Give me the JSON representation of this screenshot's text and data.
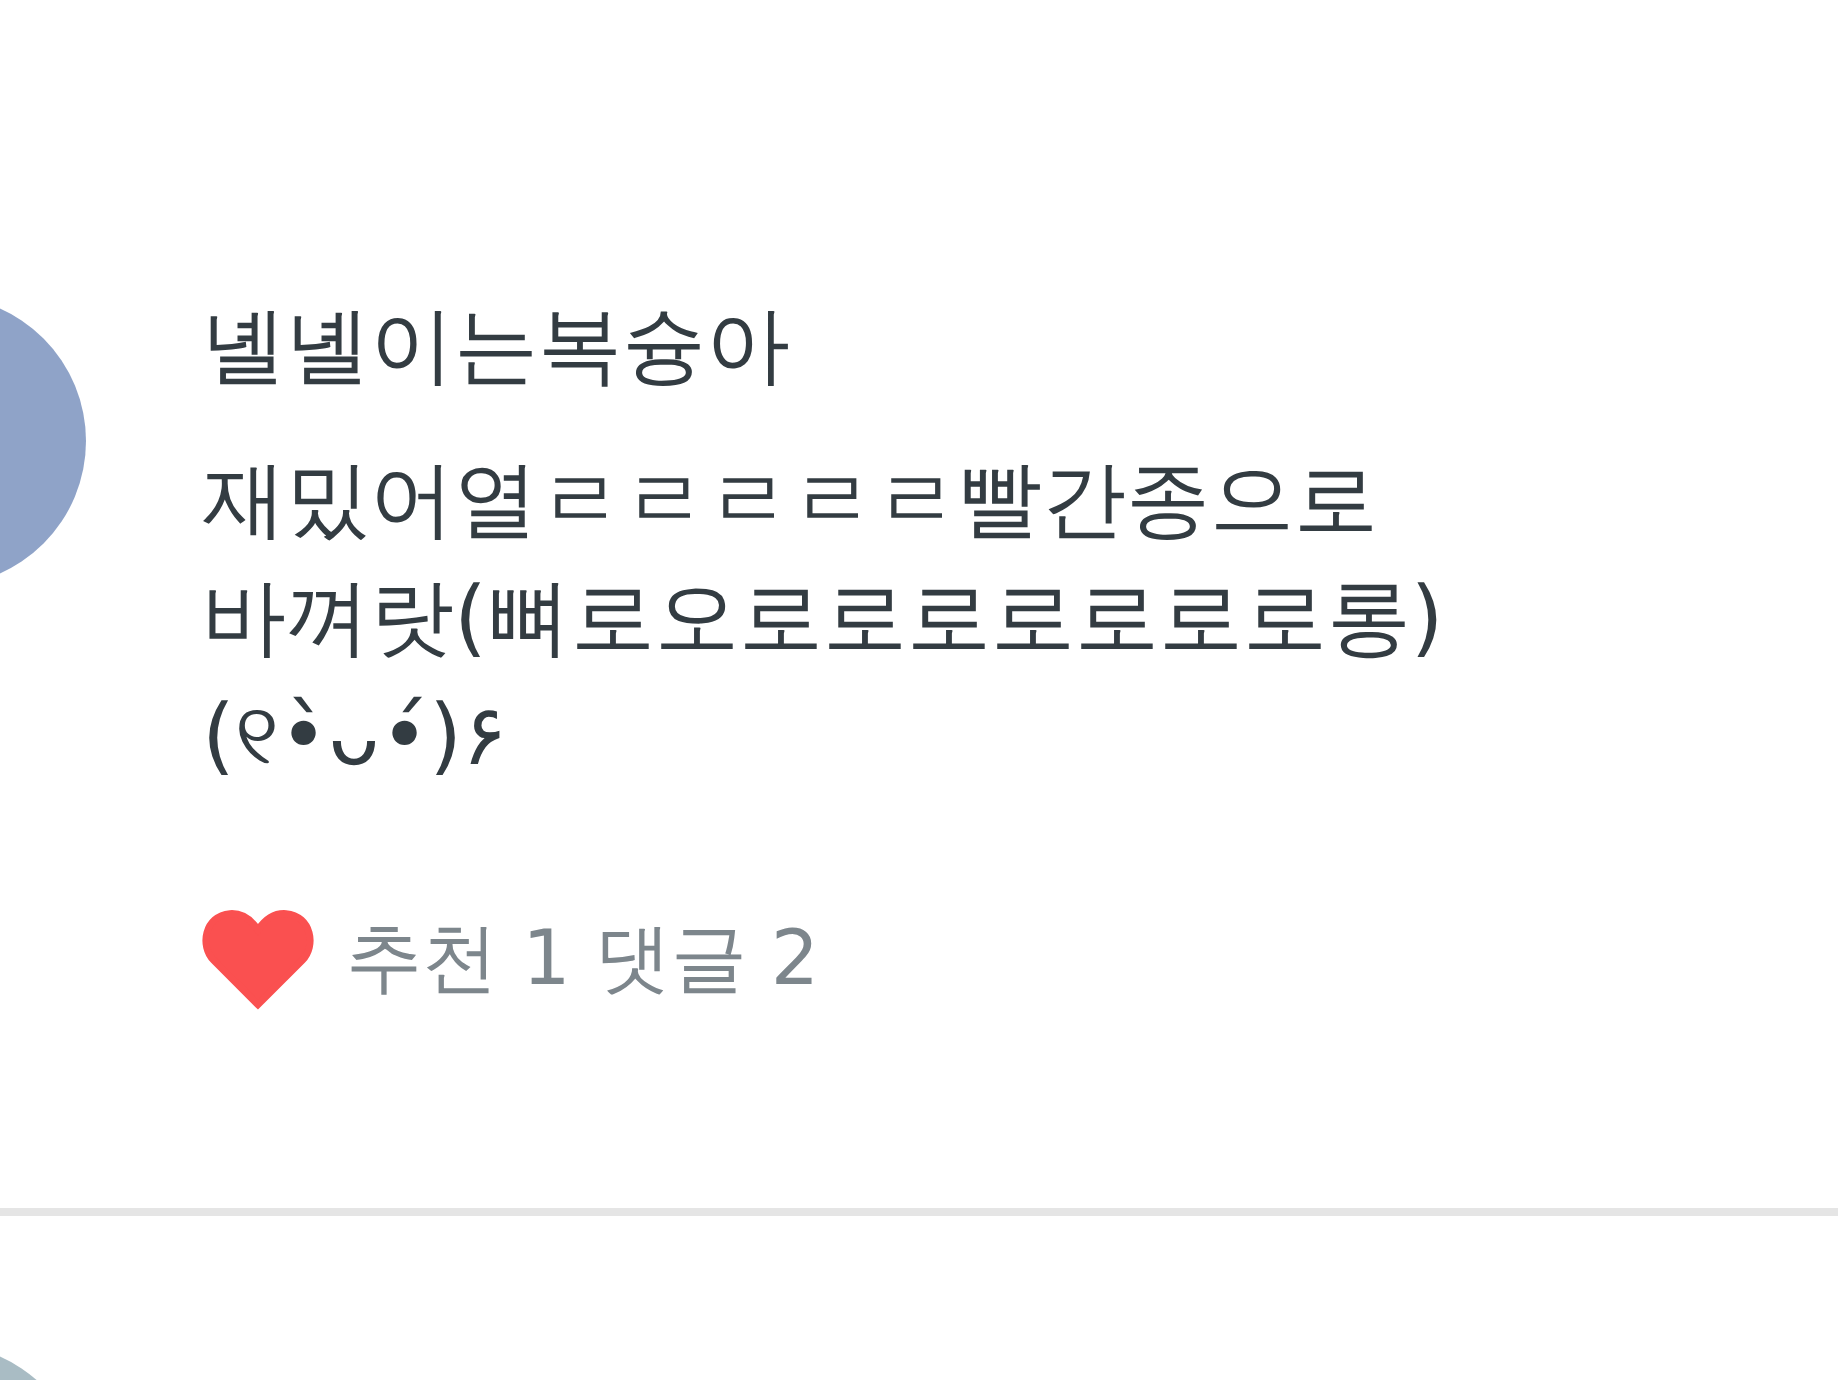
{
  "comments": [
    {
      "author": "녤녤이는복슝아",
      "body": "재밌어열ㄹㄹㄹㄹㄹ빨간종으로\n바껴랏(뼈로오로로로로로로로롱)\n(୧•̀ᴗ•́)۶",
      "liked": true,
      "stats": "추천 1 댓글 2"
    }
  ]
}
